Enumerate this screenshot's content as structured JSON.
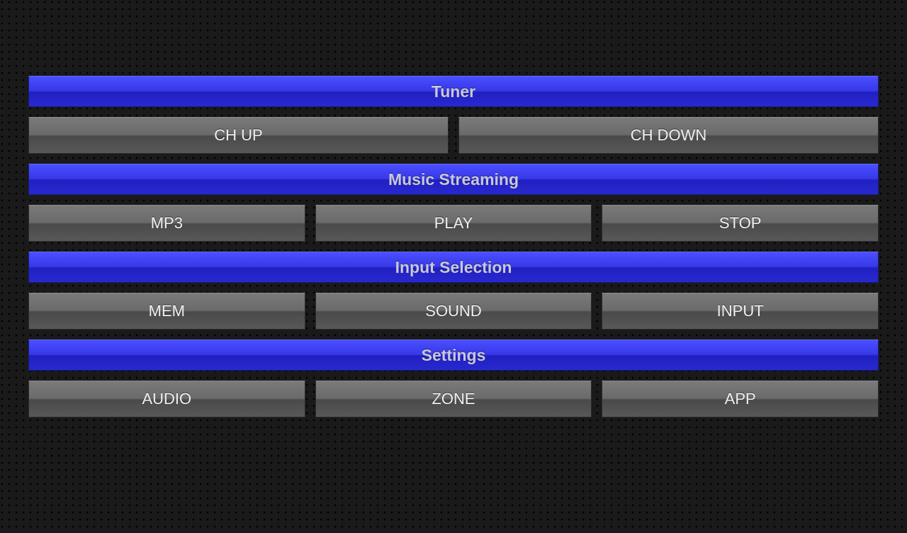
{
  "sections": {
    "tuner": {
      "title": "Tuner",
      "buttons": {
        "ch_up": "CH UP",
        "ch_down": "CH DOWN"
      }
    },
    "music_streaming": {
      "title": "Music Streaming",
      "buttons": {
        "mp3": "MP3",
        "play": "PLAY",
        "stop": "STOP"
      }
    },
    "input_selection": {
      "title": "Input Selection",
      "buttons": {
        "mem": "MEM",
        "sound": "SOUND",
        "input": "INPUT"
      }
    },
    "settings": {
      "title": "Settings",
      "buttons": {
        "audio": "AUDIO",
        "zone": "ZONE",
        "app": "APP"
      }
    }
  }
}
